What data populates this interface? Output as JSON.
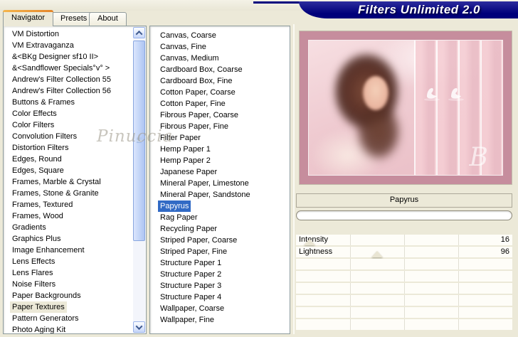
{
  "window": {
    "title": "Filters Unlimited 2.0"
  },
  "tabs": [
    {
      "label": "Navigator",
      "active": true
    },
    {
      "label": "Presets",
      "active": false
    },
    {
      "label": "About",
      "active": false
    }
  ],
  "watermark": "Pinuccia",
  "category_list": {
    "selected_index": 24,
    "items": [
      "VM Distortion",
      "VM Extravaganza",
      "&<BKg Designer sf10 II>",
      "&<Sandflower Specials°v° >",
      "Andrew's Filter Collection 55",
      "Andrew's Filter Collection 56",
      "Buttons & Frames",
      "Color Effects",
      "Color Filters",
      "Convolution Filters",
      "Distortion Filters",
      "Edges, Round",
      "Edges, Square",
      "Frames, Marble & Crystal",
      "Frames, Stone & Granite",
      "Frames, Textured",
      "Frames, Wood",
      "Gradients",
      "Graphics Plus",
      "Image Enhancement",
      "Lens Effects",
      "Lens Flares",
      "Noise Filters",
      "Paper Backgrounds",
      "Paper Textures",
      "Pattern Generators",
      "Photo Aging Kit"
    ]
  },
  "filter_list": {
    "selected_index": 15,
    "items": [
      "Canvas, Coarse",
      "Canvas, Fine",
      "Canvas, Medium",
      "Cardboard Box, Coarse",
      "Cardboard Box, Fine",
      "Cotton Paper, Coarse",
      "Cotton Paper, Fine",
      "Fibrous Paper, Coarse",
      "Fibrous Paper, Fine",
      "Filter Paper",
      "Hemp Paper 1",
      "Hemp Paper 2",
      "Japanese Paper",
      "Mineral Paper, Limestone",
      "Mineral Paper, Sandstone",
      "Papyrus",
      "Rag Paper",
      "Recycling Paper",
      "Striped Paper, Coarse",
      "Striped Paper, Fine",
      "Structure Paper 1",
      "Structure Paper 2",
      "Structure Paper 3",
      "Structure Paper 4",
      "Wallpaper, Coarse",
      "Wallpaper, Fine"
    ]
  },
  "preview": {
    "filter_name": "Papyrus",
    "progress_percent": 0,
    "signature": "B"
  },
  "params": {
    "rows": [
      {
        "label": "Intensity",
        "value": "16",
        "handle_percent": 6.3
      },
      {
        "label": "Lightness",
        "value": "96",
        "handle_percent": 37.6
      },
      {
        "label": "",
        "value": "",
        "handle_percent": null
      },
      {
        "label": "",
        "value": "",
        "handle_percent": null
      },
      {
        "label": "",
        "value": "",
        "handle_percent": null
      },
      {
        "label": "",
        "value": "",
        "handle_percent": null
      },
      {
        "label": "",
        "value": "",
        "handle_percent": null
      },
      {
        "label": "",
        "value": "",
        "handle_percent": null
      }
    ]
  },
  "colors": {
    "selection_blue": "#316AC5",
    "inactive_selection": "#ECE9D8",
    "banner_navy": "#00007E",
    "tab_accent_orange": "#E5862A",
    "preview_mauve": "#C68D9D",
    "dialog_background": "#ECE9D8"
  }
}
